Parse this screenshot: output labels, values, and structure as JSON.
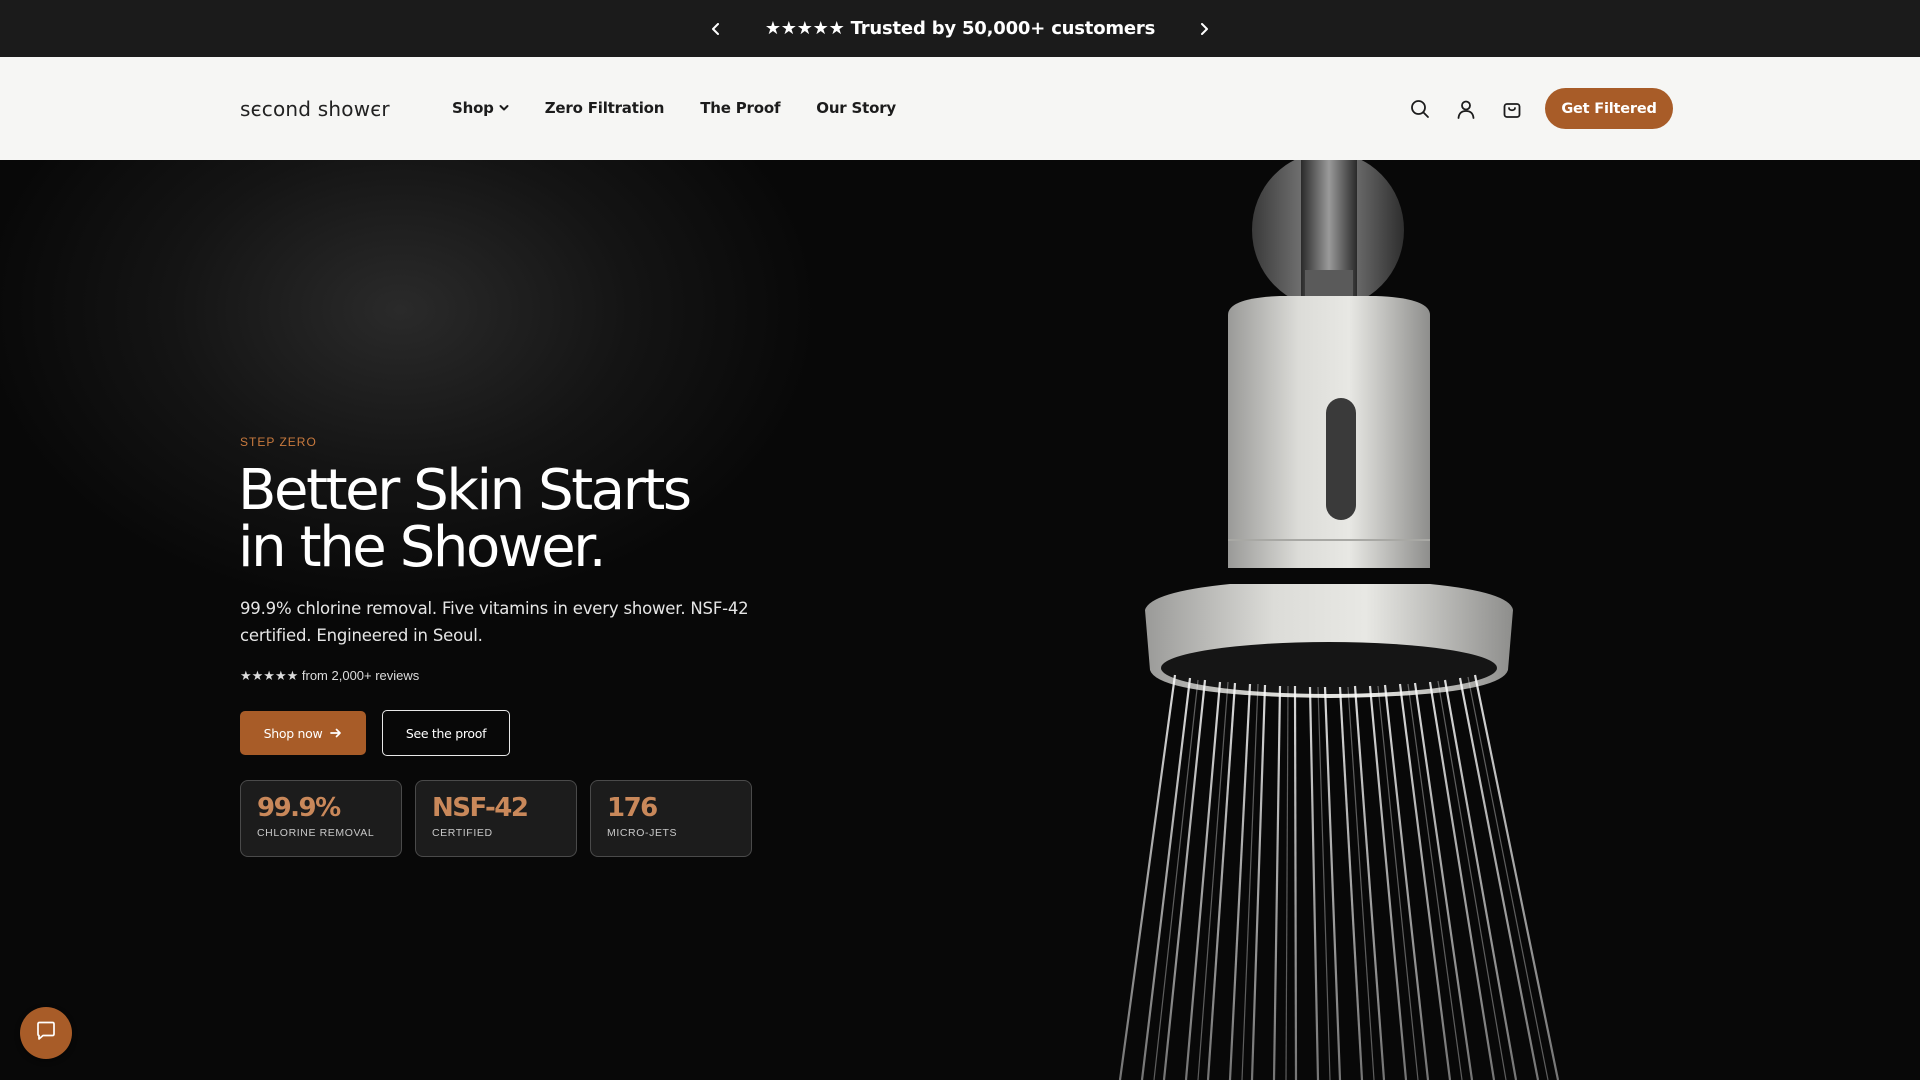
{
  "announcement": {
    "text": "★★★★★ Trusted by 50,000+ customers",
    "prev_icon": "chevron-left-icon",
    "next_icon": "chevron-right-icon"
  },
  "header": {
    "logo": "sєcond showєr",
    "nav": [
      {
        "label": "Shop",
        "has_dropdown": true
      },
      {
        "label": "Zero Filtration"
      },
      {
        "label": "The Proof"
      },
      {
        "label": "Our Story"
      }
    ],
    "icons": [
      "search-icon",
      "account-icon",
      "cart-icon"
    ],
    "cta_label": "Get Filtered"
  },
  "hero": {
    "eyebrow": "STEP ZERO",
    "headline_line1": "Better Skin Starts",
    "headline_line2": "in the Shower.",
    "subtext": "99.9% chlorine removal. Five vitamins in every shower. NSF-42 certified. Engineered in Seoul.",
    "reviews": "★★★★★ from 2,000+ reviews",
    "primary_button": "Shop now",
    "secondary_button": "See the proof",
    "stats": [
      {
        "value": "99.9%",
        "label": "CHLORINE REMOVAL"
      },
      {
        "value": "NSF-42",
        "label": "CERTIFIED"
      },
      {
        "value": "176",
        "label": "MICRO-JETS"
      }
    ]
  },
  "chat": {
    "icon": "chat-icon"
  },
  "colors": {
    "accent": "#a85c28",
    "stat_value": "#c9885a",
    "announcement_bg": "#1b1b1b",
    "header_bg": "#f6f6f4",
    "hero_bg": "#0b0b0b"
  }
}
